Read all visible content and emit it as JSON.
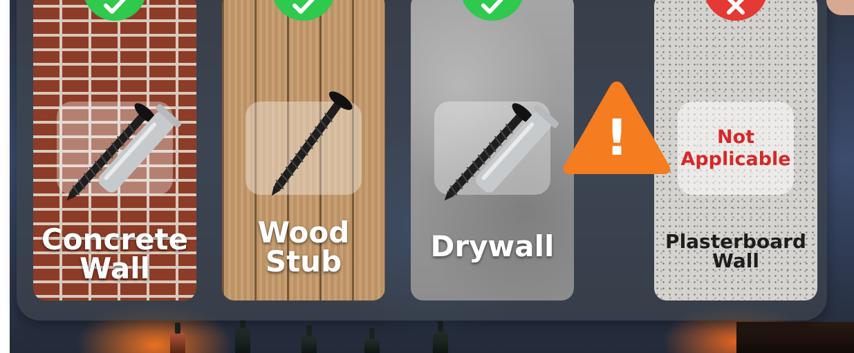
{
  "cards": [
    {
      "name": "Concrete Wall",
      "line1": "Concrete",
      "line2": "Wall",
      "status": "check",
      "material": "brick",
      "fastener": "screw-and-anchor"
    },
    {
      "name": "Wood Stub",
      "line1": "Wood",
      "line2": "Stub",
      "status": "check",
      "material": "wood",
      "fastener": "screw"
    },
    {
      "name": "Drywall",
      "line1": "Drywall",
      "line2": "",
      "status": "check",
      "material": "concrete",
      "fastener": "screw-and-anchor"
    },
    {
      "name": "Plasterboard Wall",
      "line1": "Plasterboard",
      "line2": "Wall",
      "status": "cross",
      "material": "plaster",
      "fastener": "none"
    }
  ],
  "not_applicable": {
    "line1": "Not",
    "line2": "Applicable"
  },
  "warning": {
    "symbol": "!",
    "icon": "warning-triangle-icon",
    "color": "#f57c1f"
  },
  "colors": {
    "check": "#2ec94d",
    "cross": "#e53935",
    "na_text": "#d62828"
  }
}
